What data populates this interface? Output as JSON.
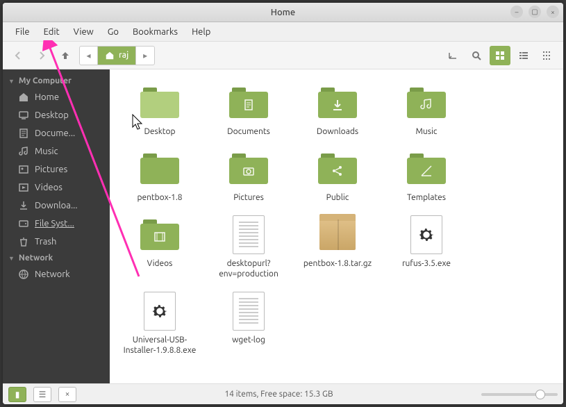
{
  "window": {
    "title": "Home"
  },
  "menubar": [
    "File",
    "Edit",
    "View",
    "Go",
    "Bookmarks",
    "Help"
  ],
  "pathbar": {
    "location": "raj"
  },
  "sidebar": {
    "sections": [
      {
        "title": "My Computer",
        "items": [
          {
            "icon": "home",
            "label": "Home"
          },
          {
            "icon": "desktop",
            "label": "Desktop"
          },
          {
            "icon": "doc",
            "label": "Docume..."
          },
          {
            "icon": "music",
            "label": "Music"
          },
          {
            "icon": "pictures",
            "label": "Pictures"
          },
          {
            "icon": "videos",
            "label": "Videos"
          },
          {
            "icon": "download",
            "label": "Downloa..."
          },
          {
            "icon": "disk",
            "label": "File Syst...",
            "selected": true
          },
          {
            "icon": "trash",
            "label": "Trash"
          }
        ]
      },
      {
        "title": "Network",
        "items": [
          {
            "icon": "globe",
            "label": "Network"
          }
        ]
      }
    ]
  },
  "files": [
    {
      "type": "folder-open",
      "glyph": "",
      "label": "Desktop"
    },
    {
      "type": "folder",
      "glyph": "doc",
      "label": "Documents"
    },
    {
      "type": "folder",
      "glyph": "download",
      "label": "Downloads"
    },
    {
      "type": "folder",
      "glyph": "music",
      "label": "Music"
    },
    {
      "type": "folder",
      "glyph": "",
      "label": "pentbox-1.8"
    },
    {
      "type": "folder",
      "glyph": "camera",
      "label": "Pictures"
    },
    {
      "type": "folder",
      "glyph": "share",
      "label": "Public"
    },
    {
      "type": "folder",
      "glyph": "template",
      "label": "Templates"
    },
    {
      "type": "folder",
      "glyph": "video",
      "label": "Videos"
    },
    {
      "type": "text",
      "label": "desktopurl?env=production"
    },
    {
      "type": "package",
      "label": "pentbox-1.8.tar.gz"
    },
    {
      "type": "exe",
      "label": "rufus-3.5.exe"
    },
    {
      "type": "exe",
      "label": "Universal-USB-Installer-1.9.8.8.exe"
    },
    {
      "type": "text",
      "label": "wget-log"
    }
  ],
  "status": "14 items, Free space: 15.3 GB"
}
